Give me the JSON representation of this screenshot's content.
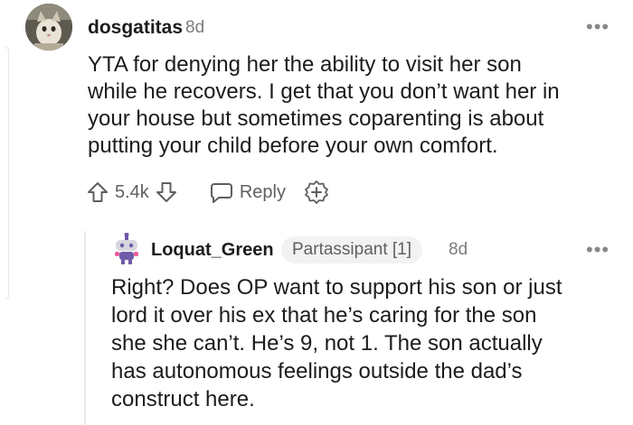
{
  "comment": {
    "username": "dosgatitas",
    "age": "8d",
    "more": "•••",
    "lines": [
      "YTA for denying her the ability to visit her son",
      "while he recovers. I get that you don’t want her in",
      "your house but sometimes coparenting is about",
      "putting your child before your own comfort."
    ],
    "score": "5.4k",
    "reply_label": "Reply"
  },
  "reply": {
    "username": "Loquat_Green",
    "flair": "Partassipant [1]",
    "age": "8d",
    "more": "•••",
    "lines": [
      "Right? Does OP want to support his son or just",
      "lord it over his ex that he’s caring for the son",
      "she she can’t. He’s 9, not 1. The son actually",
      "has autonomous feelings outside the dad’s",
      "construct here."
    ]
  },
  "colors": {
    "text": "#1c1c1c",
    "meta": "#7c7c7c",
    "action": "#5f5f5f",
    "flair_bg": "#f2f2f2",
    "thread_line": "#ececec",
    "snoo_purple": "#6f5ba7"
  }
}
